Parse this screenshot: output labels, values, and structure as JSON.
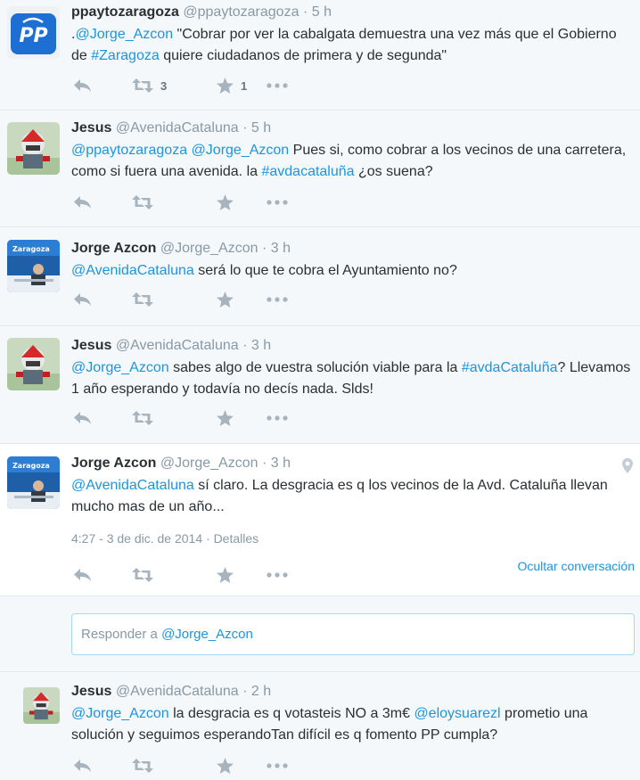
{
  "tweets": [
    {
      "fullname": "ppaytozaragoza",
      "username": "@ppaytozaragoza",
      "time": "5 h",
      "text": [
        {
          "t": ".",
          "link": false
        },
        {
          "t": "@Jorge_Azcon",
          "link": true
        },
        {
          "t": " \"Cobrar por ver la cabalgata demuestra una vez más que el Gobierno de ",
          "link": false
        },
        {
          "t": "#Zaragoza",
          "link": true
        },
        {
          "t": " quiere ciudadanos de primera y de segunda\"",
          "link": false
        }
      ],
      "retweets": "3",
      "favorites": "1"
    },
    {
      "fullname": "Jesus",
      "username": "@AvenidaCataluna",
      "time": "5 h",
      "text": [
        {
          "t": "@ppaytozaragoza",
          "link": true
        },
        {
          "t": " ",
          "link": false
        },
        {
          "t": "@Jorge_Azcon",
          "link": true
        },
        {
          "t": " Pues si, como cobrar a los vecinos de una carretera, como si fuera una avenida. la ",
          "link": false
        },
        {
          "t": "#avdacataluña",
          "link": true
        },
        {
          "t": " ¿os suena?",
          "link": false
        }
      ],
      "retweets": "",
      "favorites": ""
    },
    {
      "fullname": "Jorge Azcon",
      "username": "@Jorge_Azcon",
      "time": "3 h",
      "text": [
        {
          "t": "@AvenidaCataluna",
          "link": true
        },
        {
          "t": " será lo que te cobra el Ayuntamiento no?",
          "link": false
        }
      ],
      "retweets": "",
      "favorites": ""
    },
    {
      "fullname": "Jesus",
      "username": "@AvenidaCataluna",
      "time": "3 h",
      "text": [
        {
          "t": "@Jorge_Azcon",
          "link": true
        },
        {
          "t": " sabes algo de vuestra solución viable para la ",
          "link": false
        },
        {
          "t": "#avdaCataluña",
          "link": true
        },
        {
          "t": "? Llevamos 1 año esperando y todavía no decís nada. Slds!",
          "link": false
        }
      ],
      "retweets": "",
      "favorites": ""
    },
    {
      "fullname": "Jorge Azcon",
      "username": "@Jorge_Azcon",
      "time": "3 h",
      "text": [
        {
          "t": "@AvenidaCataluna",
          "link": true
        },
        {
          "t": " sí claro. La desgracia es q los vecinos de la Avd. Cataluña llevan mucho mas de un año...",
          "link": false
        }
      ],
      "timestamp": "4:27 - 3 de dic. de 2014",
      "details_label": "Detalles",
      "hide_conversation": "Ocultar conversación",
      "retweets": "",
      "favorites": ""
    },
    {
      "fullname": "Jesus",
      "username": "@AvenidaCataluna",
      "time": "2 h",
      "text": [
        {
          "t": "@Jorge_Azcon",
          "link": true
        },
        {
          "t": " la desgracia es q votasteis NO a 3m€ ",
          "link": false
        },
        {
          "t": "@eloysuarezl",
          "link": true
        },
        {
          "t": " prometio una solución y seguimos esperandoTan difícil es q fomento PP cumpla?",
          "link": false
        }
      ],
      "retweets": "",
      "favorites": ""
    }
  ],
  "reply_box": {
    "prefix": "Responder a ",
    "handle": "@Jorge_Azcon"
  },
  "separator": "·",
  "colors": {
    "link": "#1b95e0",
    "muted": "#8899a6",
    "action": "#a7b3bd",
    "selected_bg": "#ffffff",
    "stream_bg": "#f5f8fa"
  },
  "icons": {
    "reply": "reply-icon",
    "retweet": "retweet-icon",
    "favorite": "star-icon",
    "more": "more-icon",
    "geo": "location-pin-icon"
  }
}
